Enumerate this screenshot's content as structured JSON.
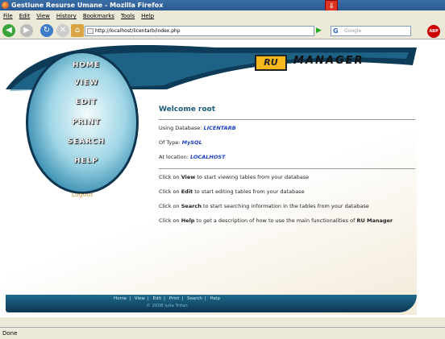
{
  "window": {
    "title": "Gestiune Resurse Umane - Mozilla Firefox"
  },
  "menu": [
    "File",
    "Edit",
    "View",
    "History",
    "Bookmarks",
    "Tools",
    "Help"
  ],
  "address": {
    "url": "http://localhost/licentarb/index.php"
  },
  "search": {
    "placeholder": "Google",
    "engine": "G"
  },
  "sidebar": {
    "items": [
      "HOME",
      "VIEW",
      "EDIT",
      "PRINT",
      "SEARCH",
      "HELP"
    ],
    "logout": "Logout"
  },
  "logo": {
    "ru": "RU",
    "manager": "MANAGER"
  },
  "main": {
    "welcome": "Welcome root",
    "db_label": "Using Database:",
    "db_value": "LICENTARB",
    "type_label": "Of Type:",
    "type_value": "MySQL",
    "loc_label": "At location:",
    "loc_value": "LOCALHOST",
    "view_pre": "Click on",
    "view_kw": "View",
    "view_post": "to start viewing tables from your database",
    "edit_pre": "Click on",
    "edit_kw": "Edit",
    "edit_post": "to start editing tables from your database",
    "search_pre": "Click on",
    "search_kw": "Search",
    "search_post": "to start searching information in the tables from your database",
    "help_pre": "Click on",
    "help_kw": "Help",
    "help_post": "to get a description of how to use the main functionalities of",
    "help_app": "RU Manager"
  },
  "footer": {
    "links": [
      "Home",
      "View",
      "Edit",
      "Print",
      "Search",
      "Help"
    ],
    "copyright": "© 2008 Iulia Trifan"
  },
  "status": {
    "text": "Done"
  }
}
